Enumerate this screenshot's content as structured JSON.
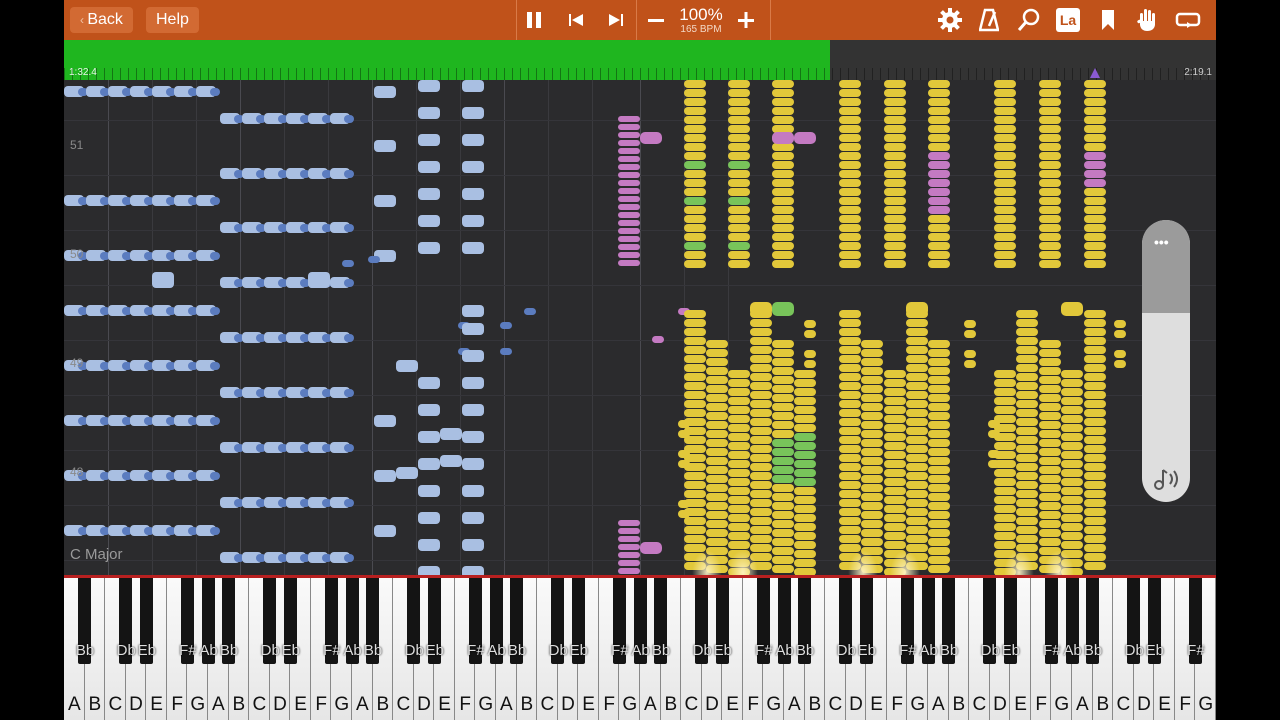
{
  "toolbar": {
    "back_label": "Back",
    "help_label": "Help",
    "zoom_percent": "100%",
    "bpm": "165 BPM",
    "note_label_button": "La",
    "icons": [
      "pause-icon",
      "skip-back-icon",
      "skip-forward-icon",
      "minus-icon",
      "plus-icon",
      "gear-icon",
      "metronome-icon",
      "search-icon",
      "bookmark-icon",
      "hand-icon",
      "loop-icon"
    ]
  },
  "progress": {
    "time_current": "1:32.4",
    "time_total": "2:19.1",
    "fraction": 0.665,
    "fill_color": "#1fb61f"
  },
  "score": {
    "measures": [
      "51",
      "50",
      "49",
      "48"
    ],
    "key_signature": "C Major"
  },
  "volume": {
    "more_label": "•••",
    "level": 0.67
  },
  "keyboard": {
    "white_keys": [
      "A",
      "B",
      "C",
      "D",
      "E",
      "F",
      "G",
      "A",
      "B",
      "C",
      "D",
      "E",
      "F",
      "G",
      "A",
      "B",
      "C",
      "D",
      "E",
      "F",
      "G",
      "A",
      "B",
      "C",
      "D",
      "E",
      "F",
      "G",
      "A",
      "B",
      "C",
      "D",
      "E",
      "F",
      "G",
      "A",
      "B",
      "C",
      "D",
      "E",
      "F",
      "G",
      "A",
      "B",
      "C",
      "D",
      "E",
      "F",
      "G",
      "A",
      "B",
      "C",
      "D",
      "E",
      "F",
      "G"
    ],
    "black_key_labels": [
      "Bb",
      "Db",
      "Eb",
      "F#",
      "Ab",
      "Bb",
      "Db",
      "Eb",
      "F#",
      "Ab",
      "Bb",
      "Db",
      "Eb",
      "F#",
      "Ab",
      "Bb",
      "Db",
      "Eb",
      "F#",
      "Ab",
      "Bb",
      "Db",
      "Eb",
      "F#",
      "Ab",
      "Bb",
      "Db",
      "Eb",
      "F#",
      "Ab",
      "Bb",
      "Db",
      "Eb",
      "F#",
      "Ab",
      "Bb",
      "Db",
      "Eb",
      "F#",
      "Ab",
      "Bb"
    ]
  },
  "colors": {
    "toolbar": "#c0521a",
    "melody_blue": "#a9bfe2",
    "yellow_notes": "#e2c83a",
    "purple_notes": "#c47ac2",
    "green_notes": "#78c45a"
  }
}
